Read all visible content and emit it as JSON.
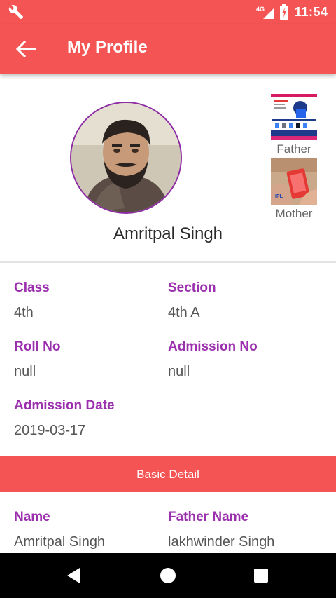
{
  "status_bar": {
    "time": "11:54",
    "network_type": "4G",
    "icons": [
      "wrench-icon",
      "signal-icon",
      "battery-icon"
    ]
  },
  "app_bar": {
    "title": "My Profile",
    "back_icon": "arrow-left-icon"
  },
  "profile": {
    "name": "Amritpal Singh",
    "parent_photos": [
      {
        "label": "Father"
      },
      {
        "label": "Mother"
      }
    ]
  },
  "details": {
    "class_label": "Class",
    "class_value": "4th",
    "section_label": "Section",
    "section_value": "4th A",
    "roll_label": "Roll No",
    "roll_value": "null",
    "admission_no_label": "Admission No",
    "admission_no_value": "null",
    "admission_date_label": "Admission Date",
    "admission_date_value": "2019-03-17"
  },
  "basic_detail": {
    "header": "Basic Detail",
    "name_label": "Name",
    "name_value": "Amritpal Singh",
    "father_label": "Father Name",
    "father_value": "lakhwinder Singh"
  },
  "nav_bar": {
    "icons": [
      "back-triangle-icon",
      "home-circle-icon",
      "recents-square-icon"
    ]
  },
  "colors": {
    "primary": "#f55454",
    "label_purple": "#9b2fae",
    "avatar_border": "#8e2ca5"
  }
}
